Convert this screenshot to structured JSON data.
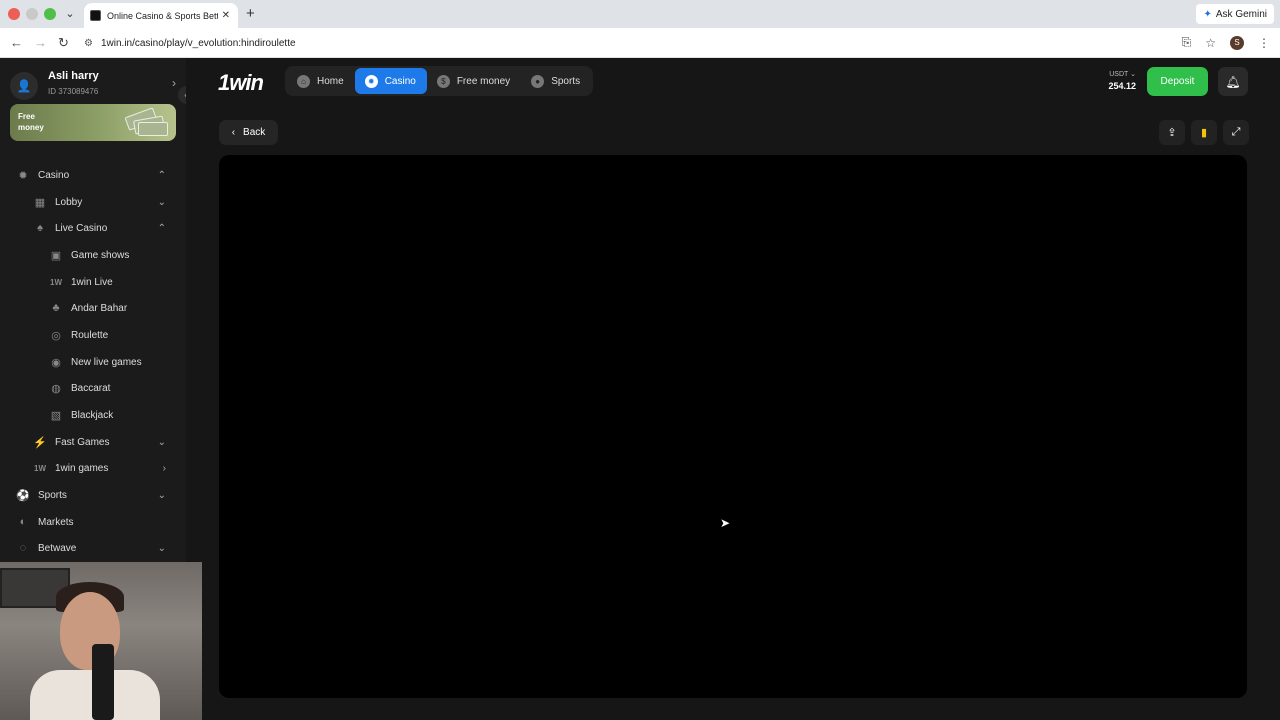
{
  "browser": {
    "tab_title": "Online Casino & Sports Betti",
    "url": "1win.in/casino/play/v_evolution:hindiroulette",
    "gemini_label": "Ask Gemini",
    "profile_initial": "S"
  },
  "user": {
    "name": "Asli harry",
    "id": "ID 373089476"
  },
  "promo": {
    "label": "Free money"
  },
  "sidebar": {
    "items": [
      {
        "label": "Casino",
        "icon": "casino-icon"
      },
      {
        "label": "Lobby",
        "icon": "lobby-icon"
      },
      {
        "label": "Live Casino",
        "icon": "live-casino-icon"
      },
      {
        "label": "Game shows",
        "icon": "game-shows-icon"
      },
      {
        "label": "1win Live",
        "icon": "1win-live-icon"
      },
      {
        "label": "Andar Bahar",
        "icon": "andar-bahar-icon"
      },
      {
        "label": "Roulette",
        "icon": "roulette-icon"
      },
      {
        "label": "New live games",
        "icon": "new-live-games-icon"
      },
      {
        "label": "Baccarat",
        "icon": "baccarat-icon"
      },
      {
        "label": "Blackjack",
        "icon": "blackjack-icon"
      },
      {
        "label": "Fast Games",
        "icon": "fast-games-icon"
      },
      {
        "label": "1win games",
        "icon": "1win-games-icon"
      },
      {
        "label": "Sports",
        "icon": "sports-icon"
      },
      {
        "label": "Markets",
        "icon": "markets-icon"
      },
      {
        "label": "Betwave",
        "icon": "betwave-icon"
      }
    ]
  },
  "header": {
    "logo": "1win",
    "nav": [
      {
        "label": "Home"
      },
      {
        "label": "Casino"
      },
      {
        "label": "Free money"
      },
      {
        "label": "Sports"
      }
    ],
    "currency": "USDT",
    "balance": "254.12",
    "deposit_label": "Deposit"
  },
  "content": {
    "back_label": "Back"
  },
  "colors": {
    "accent_blue": "#1e7ae8",
    "deposit_green": "#2fbf4a"
  }
}
